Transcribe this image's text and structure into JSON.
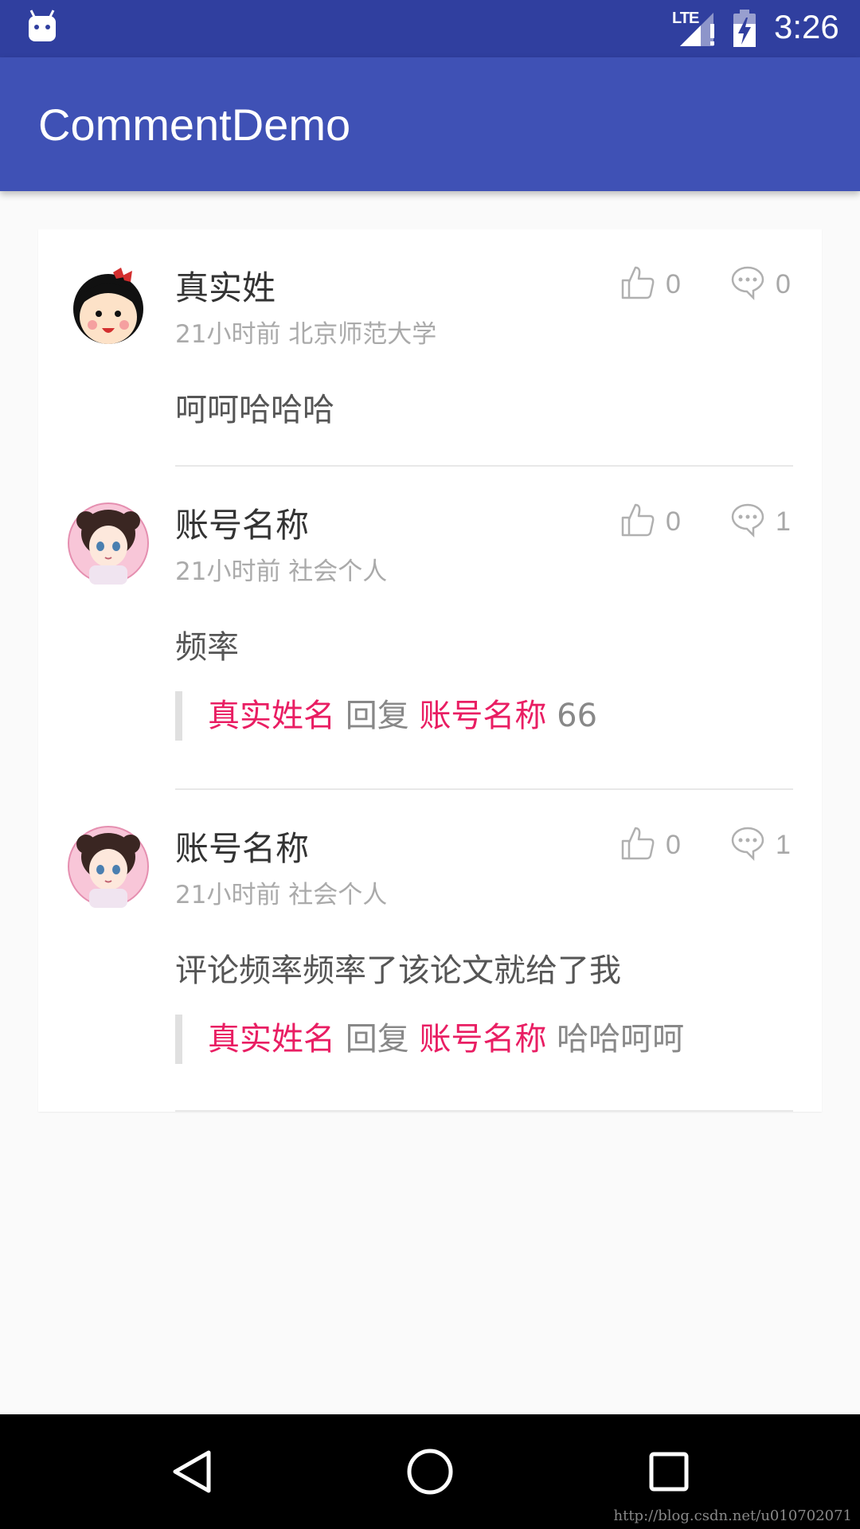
{
  "status_bar": {
    "network": "LTE",
    "time": "3:26"
  },
  "app_bar": {
    "title": "CommentDemo"
  },
  "comments": [
    {
      "name": "真实姓",
      "meta": "21小时前 北京师范大学",
      "likes": "0",
      "replies": "0",
      "content": "呵呵哈哈哈",
      "avatar_icon": "girl-bow-avatar"
    },
    {
      "name": "账号名称",
      "meta": "21小时前 社会个人",
      "likes": "0",
      "replies": "1",
      "content": "频率",
      "avatar_icon": "anime-girl-avatar",
      "reply": {
        "from": "真实姓名",
        "verb": "回复",
        "to": "账号名称",
        "text": "66"
      }
    },
    {
      "name": "账号名称",
      "meta": "21小时前 社会个人",
      "likes": "0",
      "replies": "1",
      "content": "评论频率频率了该论文就给了我",
      "avatar_icon": "anime-girl-avatar",
      "reply": {
        "from": "真实姓名",
        "verb": "回复",
        "to": "账号名称",
        "text": "哈哈呵呵"
      }
    }
  ],
  "watermark": "http://blog.csdn.net/u010702071",
  "colors": {
    "status_bar": "#303f9f",
    "app_bar": "#3f51b5",
    "reply_name": "#e91e63"
  }
}
